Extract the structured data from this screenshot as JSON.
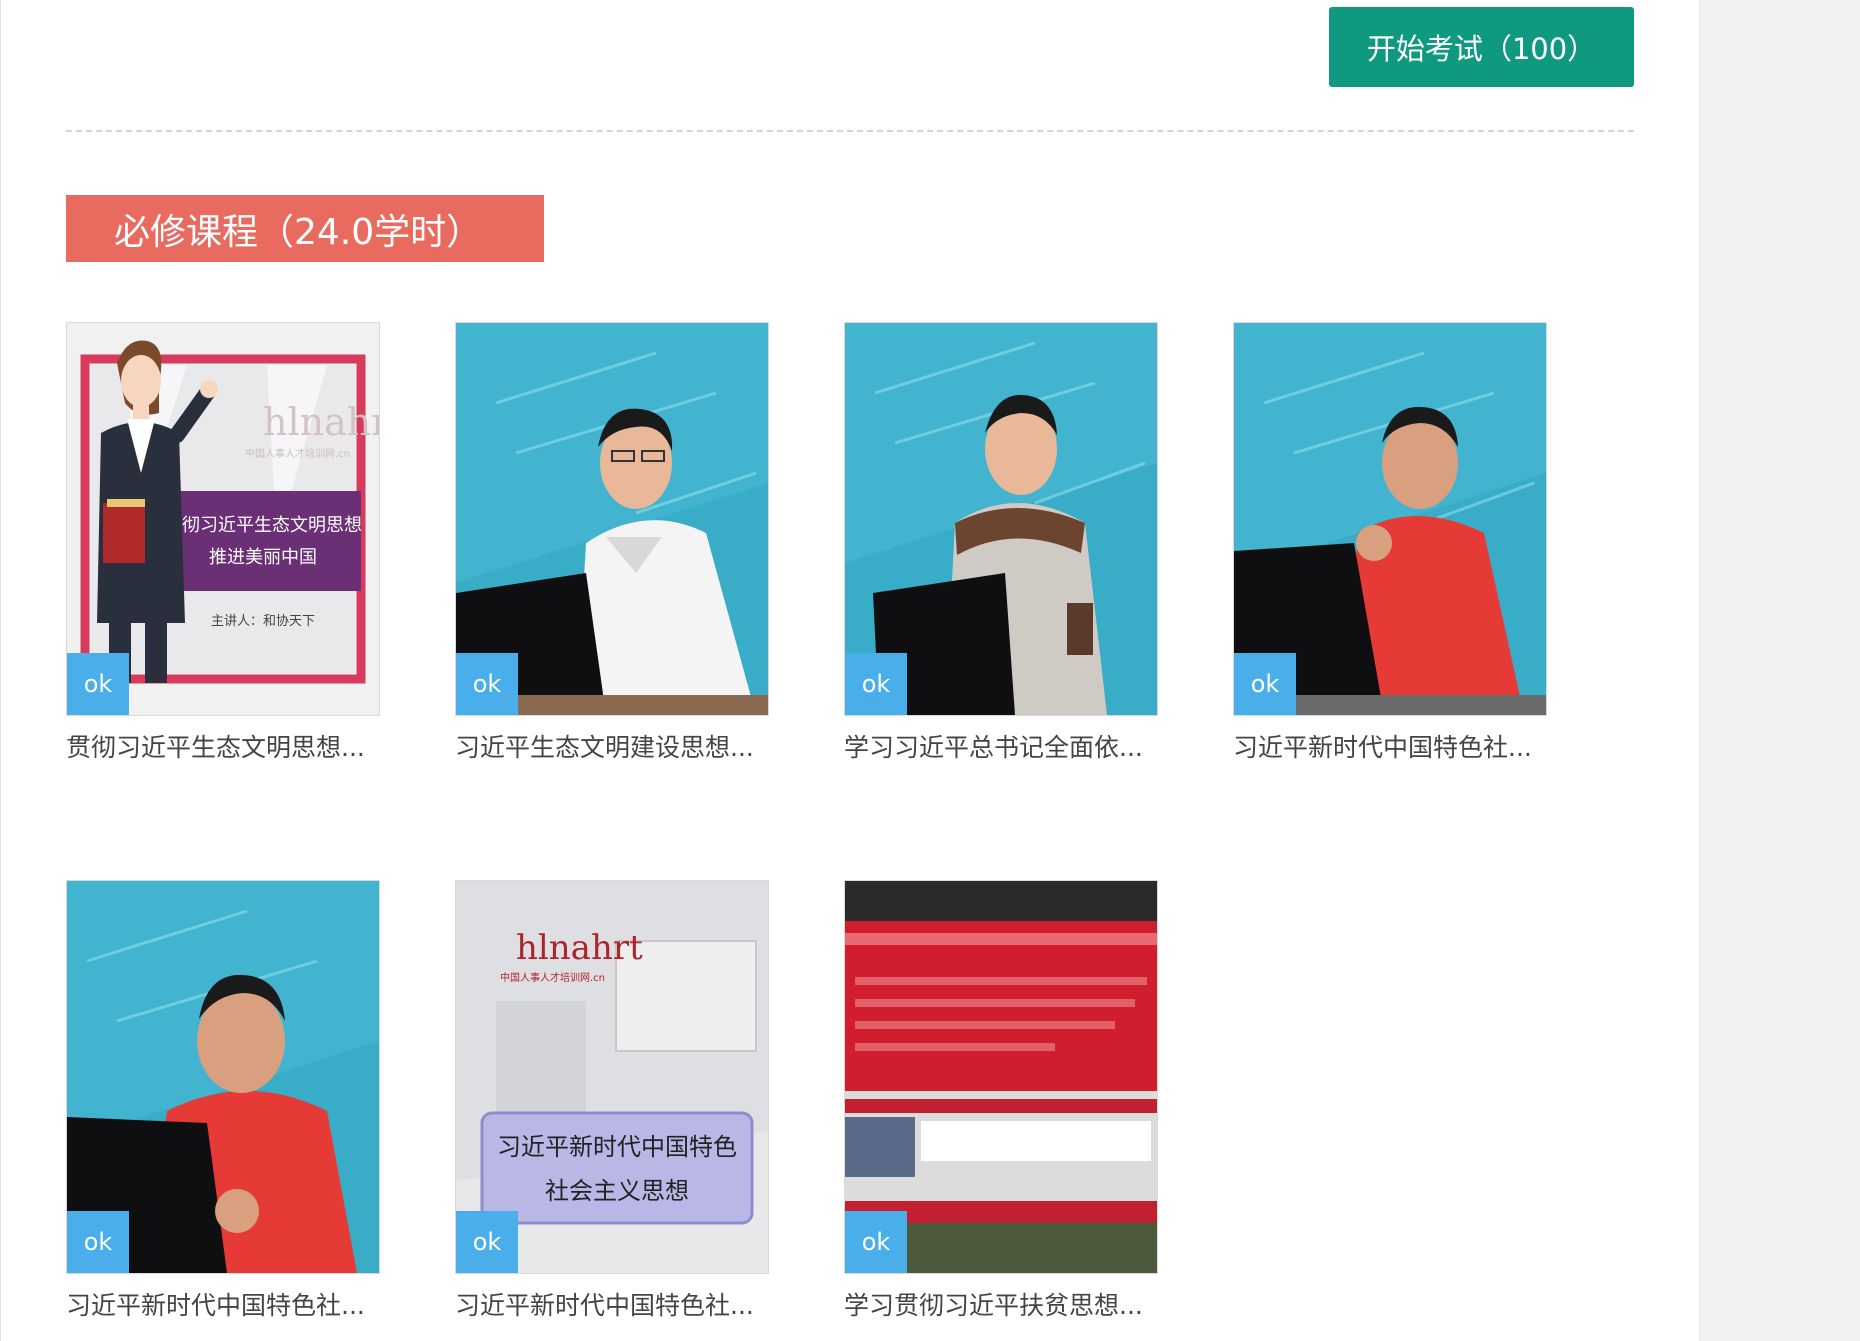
{
  "exam_button": {
    "label": "开始考试（100）"
  },
  "section": {
    "title": "必修课程（24.0学时）"
  },
  "courses": [
    {
      "title": "贯彻习近平生态文明思想...",
      "badge": "ok",
      "thumbnail": "cartoon-presenter-slide",
      "slide_line1": "贯彻习近平生态文明思想",
      "slide_line2": "推进美丽中国",
      "slide_speaker": "主讲人：和协天下",
      "logo": "hlnahrt",
      "logo_sub": "中国人事人才培训网.cn"
    },
    {
      "title": "习近平生态文明建设思想...",
      "badge": "ok",
      "thumbnail": "lecturer-white-shirt"
    },
    {
      "title": "学习习近平总书记全面依...",
      "badge": "ok",
      "thumbnail": "lecturer-grey-jacket"
    },
    {
      "title": "习近平新时代中国特色社...",
      "badge": "ok",
      "thumbnail": "lecturer-red-polo"
    },
    {
      "title": "习近平新时代中国特色社...",
      "badge": "ok",
      "thumbnail": "lecturer-red-polo-closeup"
    },
    {
      "title": "习近平新时代中国特色社...",
      "badge": "ok",
      "thumbnail": "studio-title-slide",
      "slide_line1": "习近平新时代中国特色",
      "slide_line2": "社会主义思想",
      "logo": "hlnahrt",
      "logo_sub": "中国人事人才培训网.cn"
    },
    {
      "title": "学习贯彻习近平扶贫思想...",
      "badge": "ok",
      "thumbnail": "red-news-banner"
    }
  ],
  "colors": {
    "exam_button": "#0f9a80",
    "section_heading": "#e96b5f",
    "ok_badge": "#4aaeea",
    "lecture_bg": "#39acc8"
  }
}
